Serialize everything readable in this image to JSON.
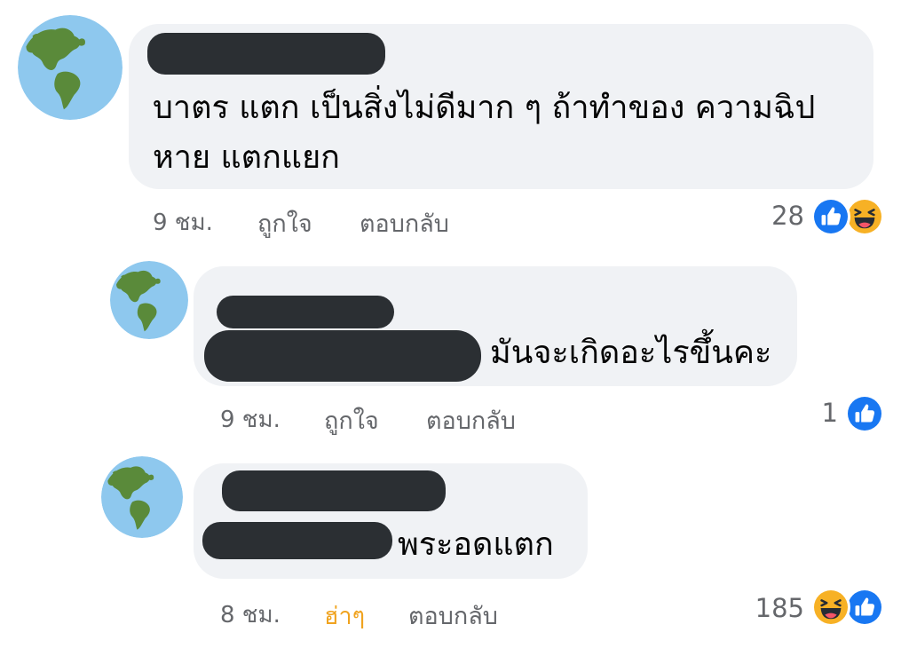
{
  "comments": [
    {
      "text_lines": [
        "บาตร แตก เป็นสิ่งไม่ดีมาก ๆ ถ้าทำของ  ความฉิป",
        "หาย แตกแยก"
      ],
      "time": "9 ชม.",
      "like_label": "ถูกใจ",
      "reply_label": "ตอบกลับ",
      "reaction_count": "28",
      "reactions": [
        "like-icon",
        "haha-icon"
      ]
    },
    {
      "text_suffix": "มันจะเกิดอะไรขึ้นคะ",
      "time": "9 ชม.",
      "like_label": "ถูกใจ",
      "reply_label": "ตอบกลับ",
      "reaction_count": "1",
      "reactions": [
        "like-icon"
      ]
    },
    {
      "text_suffix": "พระอดแตก",
      "time": "8 ชม.",
      "like_label": "ฮ่าๆ",
      "reply_label": "ตอบกลับ",
      "reaction_count": "185",
      "reactions": [
        "haha-icon",
        "like-icon"
      ]
    }
  ],
  "colors": {
    "bubble": "#f0f2f5",
    "meta_text": "#65676b",
    "haha_active": "#f0a31f",
    "like_blue": "#1877f2",
    "haha_yellow": "#f7b125",
    "avatar_ocean": "#8ec8ee",
    "avatar_land": "#5a8a3a",
    "redaction": "#2b2f33"
  }
}
